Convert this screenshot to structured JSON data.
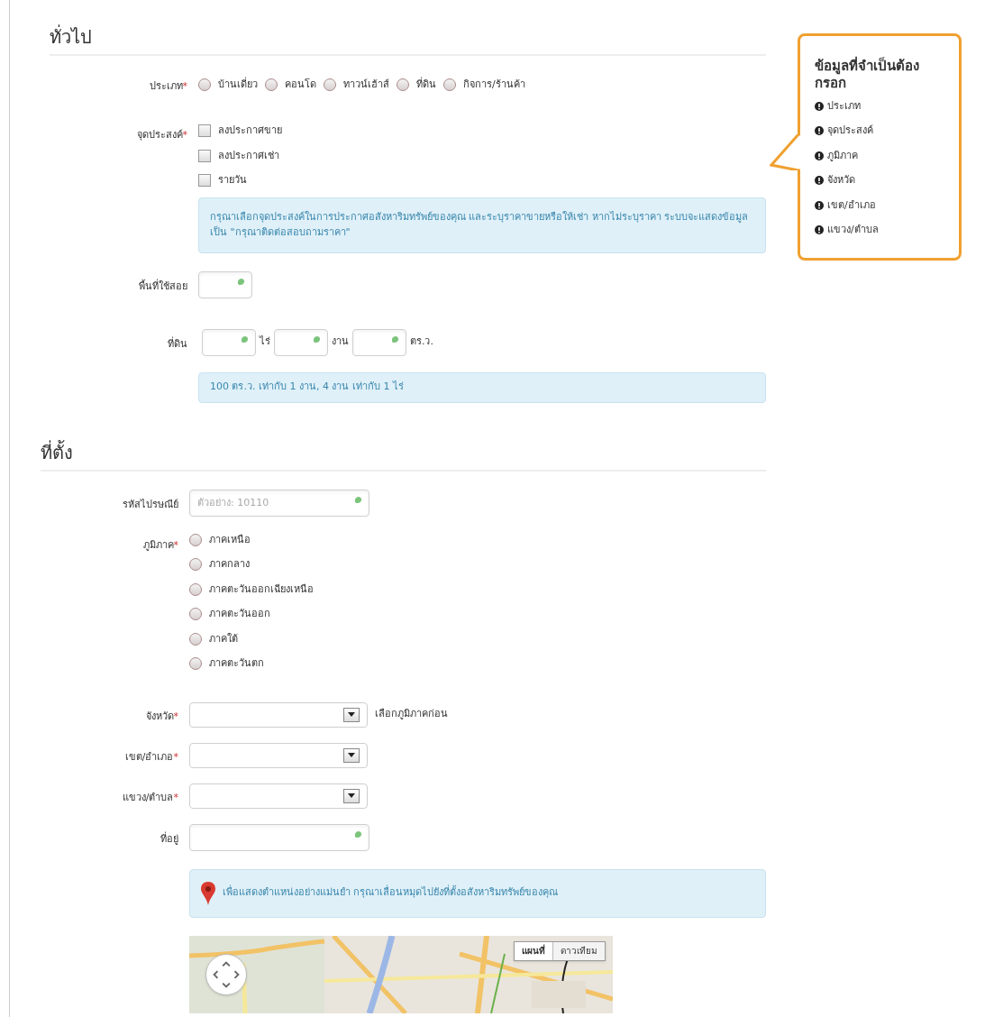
{
  "general": {
    "title": "ทั่วไป",
    "type": {
      "label": "ประเภท",
      "required_mark": "*",
      "options": [
        {
          "label": "บ้านเดี่ยว",
          "selected": false
        },
        {
          "label": "คอนโด",
          "selected": false
        },
        {
          "label": "ทาวน์เฮ้าส์",
          "selected": false
        },
        {
          "label": "ที่ดิน",
          "selected": false
        },
        {
          "label": "กิจการ/ร้านค้า",
          "selected": false
        }
      ]
    },
    "purpose": {
      "label": "จุดประสงค์",
      "required_mark": "*",
      "options": [
        {
          "label": "ลงประกาศขาย",
          "checked": false
        },
        {
          "label": "ลงประกาศเช่า",
          "checked": false
        },
        {
          "label": "รายวัน",
          "checked": false
        }
      ],
      "note": "กรุณาเลือกจุดประสงค์ในการประกาศอสังหาริมทรัพย์ของคุณ และระบุราคาขายหรือให้เช่า หากไม่ระบุราคา ระบบจะแสดงข้อมูลเป็น \"กรุณาติดต่อสอบถามราคา\""
    },
    "usable_area": {
      "label": "พื้นที่ใช้สอย"
    },
    "land": {
      "label": "ที่ดิน",
      "units": [
        "ไร่",
        "งาน",
        "ตร.ว."
      ],
      "note": "100 ตร.ว. เท่ากับ 1 งาน, 4 งาน เท่ากับ 1 ไร่"
    }
  },
  "location": {
    "title": "ที่ตั้ง",
    "postal_code": {
      "label": "รหัสไปรษณีย์",
      "placeholder": "ตัวอย่าง: 10110"
    },
    "region": {
      "label": "ภูมิภาค",
      "required_mark": "*",
      "options": [
        {
          "label": "ภาคเหนือ",
          "selected": false
        },
        {
          "label": "ภาคกลาง",
          "selected": false
        },
        {
          "label": "ภาคตะวันออกเฉียงเหนือ",
          "selected": false
        },
        {
          "label": "ภาคตะวันออก",
          "selected": false
        },
        {
          "label": "ภาคใต้",
          "selected": false
        },
        {
          "label": "ภาคตะวันตก",
          "selected": false
        }
      ]
    },
    "selects": [
      {
        "label": "จังหวัด",
        "required_mark": "*",
        "hint": "เลือกภูมิภาคก่อน"
      },
      {
        "label": "เขต/อำเภอ",
        "required_mark": "*"
      },
      {
        "label": "แขวง/ตำบล",
        "required_mark": "*"
      }
    ],
    "address": {
      "label": "ที่อยู่"
    },
    "map_note": "เพื่อแสดงตำแหน่งอย่างแม่นยำ กรุณาเลื่อนหมุดไปยังที่ตั้งอสังหาริมทรัพย์ของคุณ",
    "map": {
      "kind": "picture",
      "modes": [
        {
          "label": "แผนที่",
          "selected": true
        },
        {
          "label": "ดาวเทียม",
          "selected": false
        }
      ]
    }
  },
  "required_panel": {
    "title": "ข้อมูลที่จำเป็นต้องกรอก",
    "items": [
      "ประเภท",
      "จุดประสงค์",
      "ภูมิภาค",
      "จังหวัด",
      "เขต/อำเภอ",
      "แขวง/ตำบล"
    ]
  }
}
